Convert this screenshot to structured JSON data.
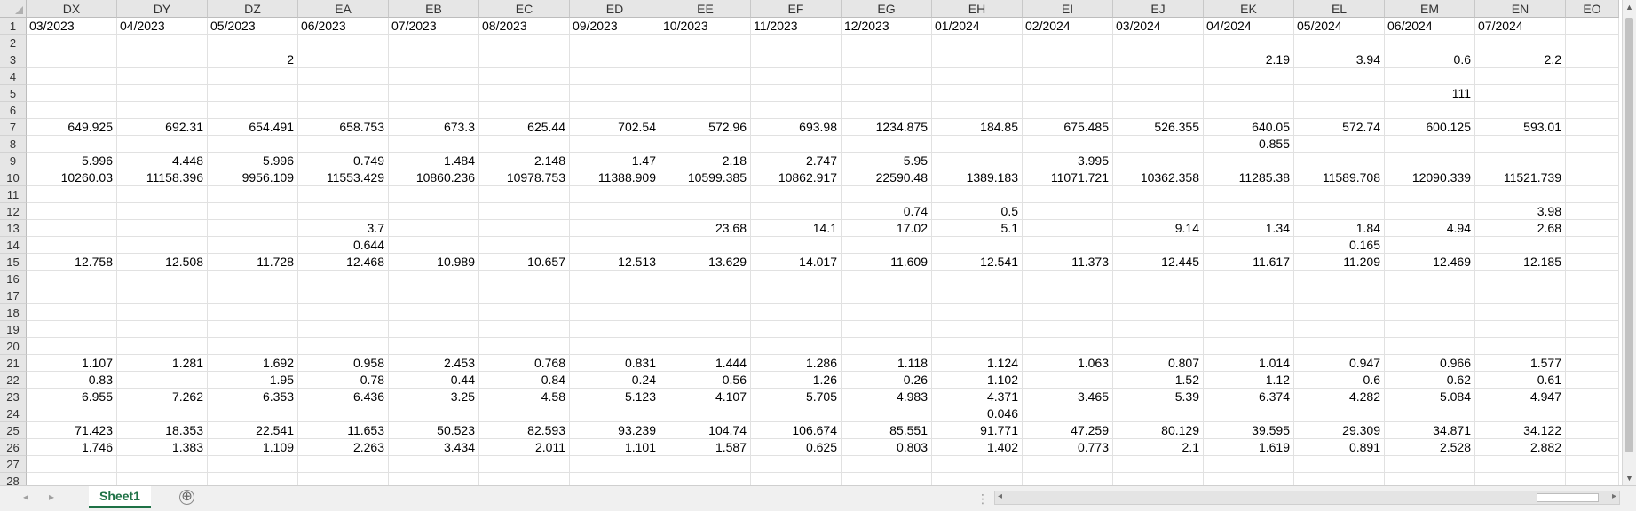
{
  "columns": [
    "DX",
    "DY",
    "DZ",
    "EA",
    "EB",
    "EC",
    "ED",
    "EE",
    "EF",
    "EG",
    "EH",
    "EI",
    "EJ",
    "EK",
    "EL",
    "EM",
    "EN",
    "EO"
  ],
  "rows": [
    [
      "03/2023",
      "04/2023",
      "05/2023",
      "06/2023",
      "07/2023",
      "08/2023",
      "09/2023",
      "10/2023",
      "11/2023",
      "12/2023",
      "01/2024",
      "02/2024",
      "03/2024",
      "04/2024",
      "05/2024",
      "06/2024",
      "07/2024",
      ""
    ],
    [
      "",
      "",
      "",
      "",
      "",
      "",
      "",
      "",
      "",
      "",
      "",
      "",
      "",
      "",
      "",
      "",
      "",
      ""
    ],
    [
      "",
      "",
      "2",
      "",
      "",
      "",
      "",
      "",
      "",
      "",
      "",
      "",
      "",
      "2.19",
      "3.94",
      "0.6",
      "2.2",
      ""
    ],
    [
      "",
      "",
      "",
      "",
      "",
      "",
      "",
      "",
      "",
      "",
      "",
      "",
      "",
      "",
      "",
      "",
      "",
      ""
    ],
    [
      "",
      "",
      "",
      "",
      "",
      "",
      "",
      "",
      "",
      "",
      "",
      "",
      "",
      "",
      "",
      "111",
      "",
      ""
    ],
    [
      "",
      "",
      "",
      "",
      "",
      "",
      "",
      "",
      "",
      "",
      "",
      "",
      "",
      "",
      "",
      "",
      "",
      ""
    ],
    [
      "649.925",
      "692.31",
      "654.491",
      "658.753",
      "673.3",
      "625.44",
      "702.54",
      "572.96",
      "693.98",
      "1234.875",
      "184.85",
      "675.485",
      "526.355",
      "640.05",
      "572.74",
      "600.125",
      "593.01",
      ""
    ],
    [
      "",
      "",
      "",
      "",
      "",
      "",
      "",
      "",
      "",
      "",
      "",
      "",
      "",
      "0.855",
      "",
      "",
      "",
      ""
    ],
    [
      "5.996",
      "4.448",
      "5.996",
      "0.749",
      "1.484",
      "2.148",
      "1.47",
      "2.18",
      "2.747",
      "5.95",
      "",
      "3.995",
      "",
      "",
      "",
      "",
      "",
      ""
    ],
    [
      "10260.03",
      "11158.396",
      "9956.109",
      "11553.429",
      "10860.236",
      "10978.753",
      "11388.909",
      "10599.385",
      "10862.917",
      "22590.48",
      "1389.183",
      "11071.721",
      "10362.358",
      "11285.38",
      "11589.708",
      "12090.339",
      "11521.739",
      ""
    ],
    [
      "",
      "",
      "",
      "",
      "",
      "",
      "",
      "",
      "",
      "",
      "",
      "",
      "",
      "",
      "",
      "",
      "",
      ""
    ],
    [
      "",
      "",
      "",
      "",
      "",
      "",
      "",
      "",
      "",
      "0.74",
      "0.5",
      "",
      "",
      "",
      "",
      "",
      "3.98",
      ""
    ],
    [
      "",
      "",
      "",
      "3.7",
      "",
      "",
      "",
      "23.68",
      "14.1",
      "17.02",
      "5.1",
      "",
      "9.14",
      "1.34",
      "1.84",
      "4.94",
      "2.68",
      ""
    ],
    [
      "",
      "",
      "",
      "0.644",
      "",
      "",
      "",
      "",
      "",
      "",
      "",
      "",
      "",
      "",
      "0.165",
      "",
      "",
      ""
    ],
    [
      "12.758",
      "12.508",
      "11.728",
      "12.468",
      "10.989",
      "10.657",
      "12.513",
      "13.629",
      "14.017",
      "11.609",
      "12.541",
      "11.373",
      "12.445",
      "11.617",
      "11.209",
      "12.469",
      "12.185",
      ""
    ],
    [
      "",
      "",
      "",
      "",
      "",
      "",
      "",
      "",
      "",
      "",
      "",
      "",
      "",
      "",
      "",
      "",
      "",
      ""
    ],
    [
      "",
      "",
      "",
      "",
      "",
      "",
      "",
      "",
      "",
      "",
      "",
      "",
      "",
      "",
      "",
      "",
      "",
      ""
    ],
    [
      "",
      "",
      "",
      "",
      "",
      "",
      "",
      "",
      "",
      "",
      "",
      "",
      "",
      "",
      "",
      "",
      "",
      ""
    ],
    [
      "",
      "",
      "",
      "",
      "",
      "",
      "",
      "",
      "",
      "",
      "",
      "",
      "",
      "",
      "",
      "",
      "",
      ""
    ],
    [
      "",
      "",
      "",
      "",
      "",
      "",
      "",
      "",
      "",
      "",
      "",
      "",
      "",
      "",
      "",
      "",
      "",
      ""
    ],
    [
      "1.107",
      "1.281",
      "1.692",
      "0.958",
      "2.453",
      "0.768",
      "0.831",
      "1.444",
      "1.286",
      "1.118",
      "1.124",
      "1.063",
      "0.807",
      "1.014",
      "0.947",
      "0.966",
      "1.577",
      ""
    ],
    [
      "0.83",
      "",
      "1.95",
      "0.78",
      "0.44",
      "0.84",
      "0.24",
      "0.56",
      "1.26",
      "0.26",
      "1.102",
      "",
      "1.52",
      "1.12",
      "0.6",
      "0.62",
      "0.61",
      ""
    ],
    [
      "6.955",
      "7.262",
      "6.353",
      "6.436",
      "3.25",
      "4.58",
      "5.123",
      "4.107",
      "5.705",
      "4.983",
      "4.371",
      "3.465",
      "5.39",
      "6.374",
      "4.282",
      "5.084",
      "4.947",
      ""
    ],
    [
      "",
      "",
      "",
      "",
      "",
      "",
      "",
      "",
      "",
      "",
      "0.046",
      "",
      "",
      "",
      "",
      "",
      "",
      ""
    ],
    [
      "71.423",
      "18.353",
      "22.541",
      "11.653",
      "50.523",
      "82.593",
      "93.239",
      "104.74",
      "106.674",
      "85.551",
      "91.771",
      "47.259",
      "80.129",
      "39.595",
      "29.309",
      "34.871",
      "34.122",
      ""
    ],
    [
      "1.746",
      "1.383",
      "1.109",
      "2.263",
      "3.434",
      "2.011",
      "1.101",
      "1.587",
      "0.625",
      "0.803",
      "1.402",
      "0.773",
      "2.1",
      "1.619",
      "0.891",
      "2.528",
      "2.882",
      ""
    ],
    [
      "",
      "",
      "",
      "",
      "",
      "",
      "",
      "",
      "",
      "",
      "",
      "",
      "",
      "",
      "",
      "",
      "",
      ""
    ],
    [
      "",
      "",
      "",
      "",
      "",
      "",
      "",
      "",
      "",
      "",
      "",
      "",
      "",
      "",
      "",
      "",
      "",
      ""
    ]
  ],
  "sheet_tab": "Sheet1",
  "add_sheet": "⊕",
  "icons": {
    "nav_prev": "◂",
    "nav_next": "▸",
    "scroll_up": "▲",
    "scroll_down": "▼",
    "scroll_left": "◂",
    "scroll_right": "▸",
    "dots": "⋮"
  },
  "colors": {
    "accent": "#1e7145",
    "header_bg": "#e6e6e6"
  }
}
